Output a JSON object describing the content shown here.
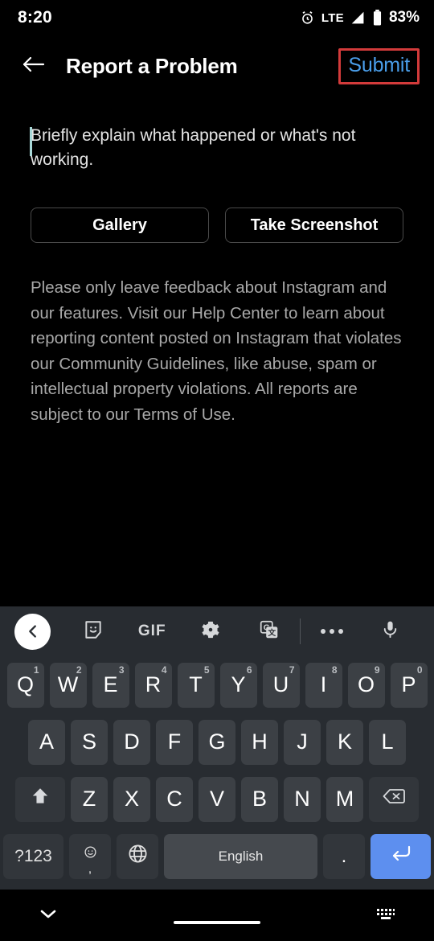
{
  "status_bar": {
    "time": "8:20",
    "network": "LTE",
    "battery_percent": "83%",
    "icons": [
      "alarm-icon",
      "signal-icon",
      "battery-icon"
    ]
  },
  "header": {
    "back_icon": "arrow-left-icon",
    "title": "Report a Problem",
    "submit_label": "Submit",
    "submit_color": "#4a9eea",
    "highlight_color": "#d33b3b"
  },
  "composer": {
    "placeholder": "Briefly explain what happened or what's not working.",
    "value": "",
    "caret_color": "#a8d8d8"
  },
  "attachments": {
    "gallery_label": "Gallery",
    "screenshot_label": "Take Screenshot"
  },
  "disclaimer": {
    "text": "Please only leave feedback about Instagram and our features. Visit our Help Center to learn about reporting content posted on Instagram that violates our Community Guidelines, like abuse, spam or intellectual property violations. All reports are subject to our Terms of Use."
  },
  "keyboard": {
    "toolbar": [
      {
        "name": "chevron-left-icon",
        "label": ""
      },
      {
        "name": "sticker-icon",
        "label": ""
      },
      {
        "name": "gif-icon",
        "label": "GIF"
      },
      {
        "name": "gear-icon",
        "label": ""
      },
      {
        "name": "translate-icon",
        "label": ""
      },
      {
        "name": "overflow-icon",
        "label": ""
      },
      {
        "name": "microphone-icon",
        "label": ""
      }
    ],
    "row1": [
      {
        "letter": "Q",
        "sup": "1"
      },
      {
        "letter": "W",
        "sup": "2"
      },
      {
        "letter": "E",
        "sup": "3"
      },
      {
        "letter": "R",
        "sup": "4"
      },
      {
        "letter": "T",
        "sup": "5"
      },
      {
        "letter": "Y",
        "sup": "6"
      },
      {
        "letter": "U",
        "sup": "7"
      },
      {
        "letter": "I",
        "sup": "8"
      },
      {
        "letter": "O",
        "sup": "9"
      },
      {
        "letter": "P",
        "sup": "0"
      }
    ],
    "row2": [
      {
        "letter": "A"
      },
      {
        "letter": "S"
      },
      {
        "letter": "D"
      },
      {
        "letter": "F"
      },
      {
        "letter": "G"
      },
      {
        "letter": "H"
      },
      {
        "letter": "J"
      },
      {
        "letter": "K"
      },
      {
        "letter": "L"
      }
    ],
    "row3": [
      {
        "letter": "Z"
      },
      {
        "letter": "X"
      },
      {
        "letter": "C"
      },
      {
        "letter": "V"
      },
      {
        "letter": "B"
      },
      {
        "letter": "N"
      },
      {
        "letter": "M"
      }
    ],
    "shift_icon": "shift-icon",
    "backspace_icon": "backspace-icon",
    "symbols_label": "?123",
    "comma_label": ",",
    "emoji_icon": "emoji-icon",
    "globe_icon": "globe-icon",
    "space_label": "English",
    "period_label": ".",
    "enter_icon": "enter-icon",
    "enter_color": "#5d8fef"
  },
  "navbar": {
    "hide_keyboard_icon": "chevron-down-icon",
    "home_indicator": "home-pill",
    "keyboard_switch_icon": "keyboard-icon"
  }
}
